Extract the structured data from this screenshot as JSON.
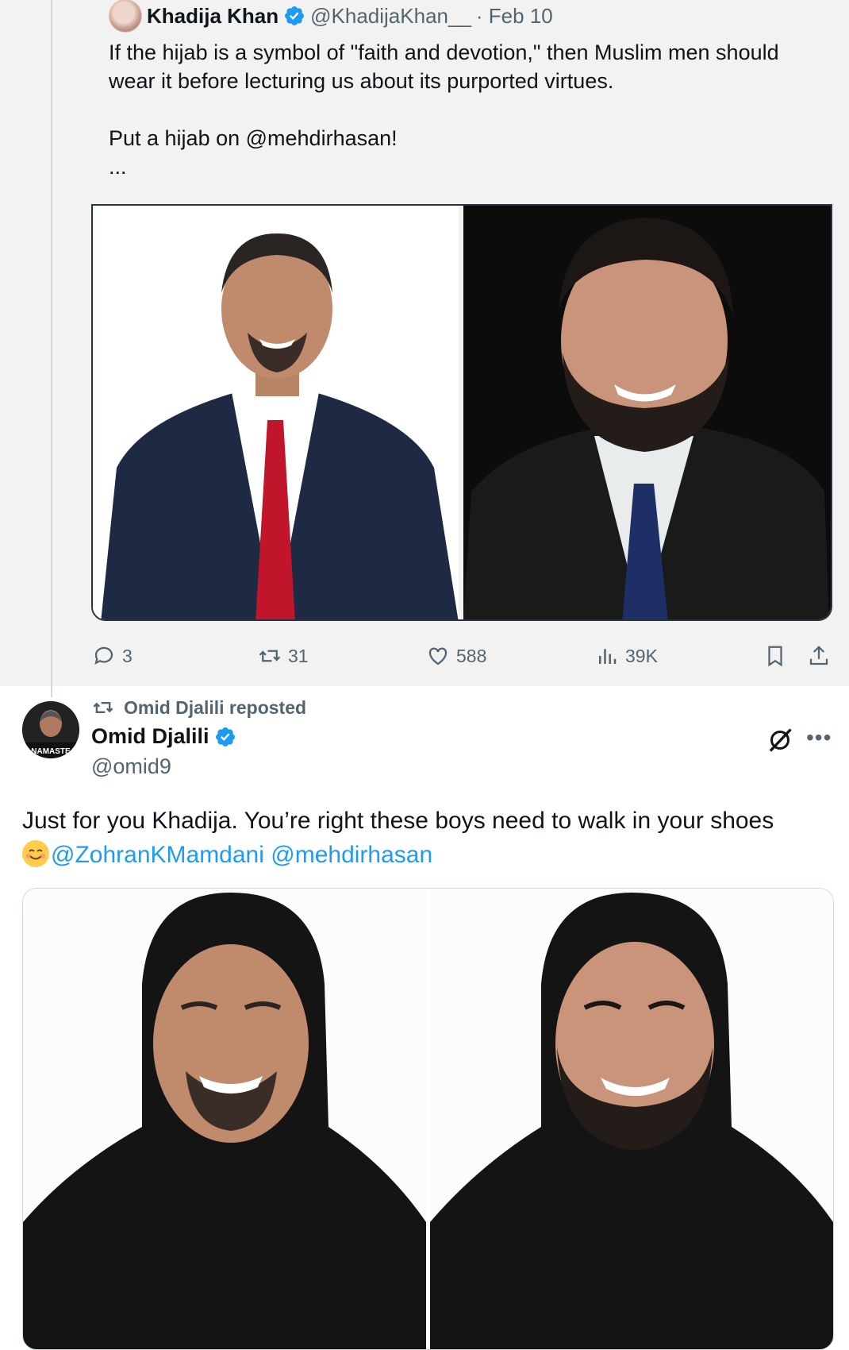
{
  "quoted_tweet": {
    "author_name": "Khadija Khan",
    "handle": "@KhadijaKhan__",
    "date": "· Feb 10",
    "text": "If the hijab is a symbol of \"faith and devotion,\" then Muslim men should wear it before lecturing us about its purported virtues.\n\nPut a hijab on @mehdirhasan!\n...",
    "images": [
      "smiling man in navy suit with red tie on white background",
      "smiling bearded man in dark suit with blue tie on black background"
    ],
    "stats": {
      "replies": "3",
      "reposts": "31",
      "likes": "588",
      "views": "39K"
    }
  },
  "repost": {
    "label": "Omid Djalili reposted",
    "author_name": "Omid Djalili",
    "handle": "@omid9",
    "avatar_text": "NAMASTE",
    "text": "Just for you Khadija. You’re right these boys need to walk in your shoes",
    "mentions": [
      "@ZohranKMamdani",
      "@mehdirhasan"
    ],
    "images": [
      "smiling man wearing black hijab",
      "smiling bearded man wearing black hijab"
    ]
  },
  "colors": {
    "accent": "#1d9bf0",
    "muted": "#536471",
    "background_top": "#f2f2f2"
  },
  "icons": [
    "reply-icon",
    "repost-icon",
    "like-icon",
    "views-icon",
    "bookmark-icon",
    "share-icon",
    "verified-badge-icon",
    "grok-icon",
    "more-icon",
    "smiling-emoji-icon"
  ]
}
